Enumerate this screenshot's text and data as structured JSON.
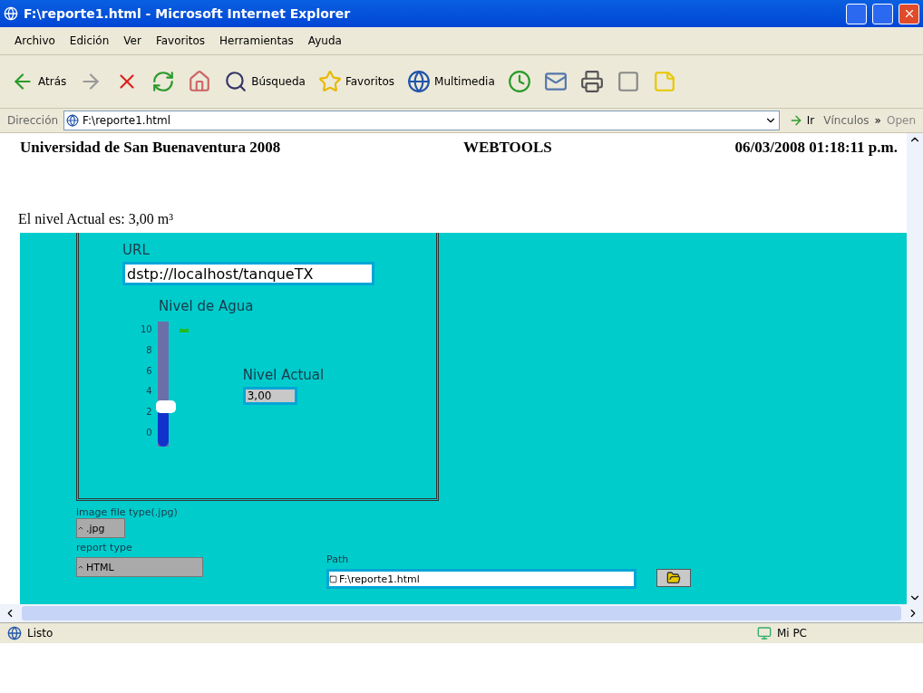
{
  "window": {
    "title": "F:\\reporte1.html - Microsoft Internet Explorer"
  },
  "menu": [
    "Archivo",
    "Edición",
    "Ver",
    "Favoritos",
    "Herramientas",
    "Ayuda"
  ],
  "toolbar": [
    {
      "kind": "back",
      "label": "Atrás"
    },
    {
      "kind": "forward"
    },
    {
      "kind": "stop"
    },
    {
      "kind": "refresh"
    },
    {
      "kind": "home"
    },
    {
      "kind": "search",
      "label": "Búsqueda"
    },
    {
      "kind": "favorites",
      "label": "Favoritos"
    },
    {
      "kind": "media",
      "label": "Multimedia"
    },
    {
      "kind": "history"
    },
    {
      "kind": "mail"
    },
    {
      "kind": "print"
    },
    {
      "kind": "edit"
    },
    {
      "kind": "note"
    }
  ],
  "address": {
    "label": "Dirección",
    "value": "F:\\reporte1.html",
    "go": "Ir",
    "links": "Vínculos",
    "more": "»",
    "cut": "Open"
  },
  "header": {
    "left": "Universidad de San Buenaventura 2008",
    "center": "WEBTOOLS",
    "right": "06/03/2008 01:18:11 p.m."
  },
  "intro": "El nivel Actual es: 3,00 m³",
  "panel": {
    "url_label": "URL",
    "url_value": "dstp://localhost/tanqueTX",
    "slider_title": "Nivel de Agua",
    "ticks": [
      "10",
      "8",
      "6",
      "4",
      "2",
      "0"
    ],
    "level": 0.3,
    "actual_label": "Nivel Actual",
    "actual_value": "3,00",
    "image_type_label": "image file type(.jpg)",
    "image_type_value": ".jpg",
    "report_type_label": "report type",
    "report_type_value": "HTML",
    "path_label": "Path",
    "path_value": "F:\\reporte1.html"
  },
  "status": {
    "text": "Listo",
    "zone": "Mi PC"
  }
}
